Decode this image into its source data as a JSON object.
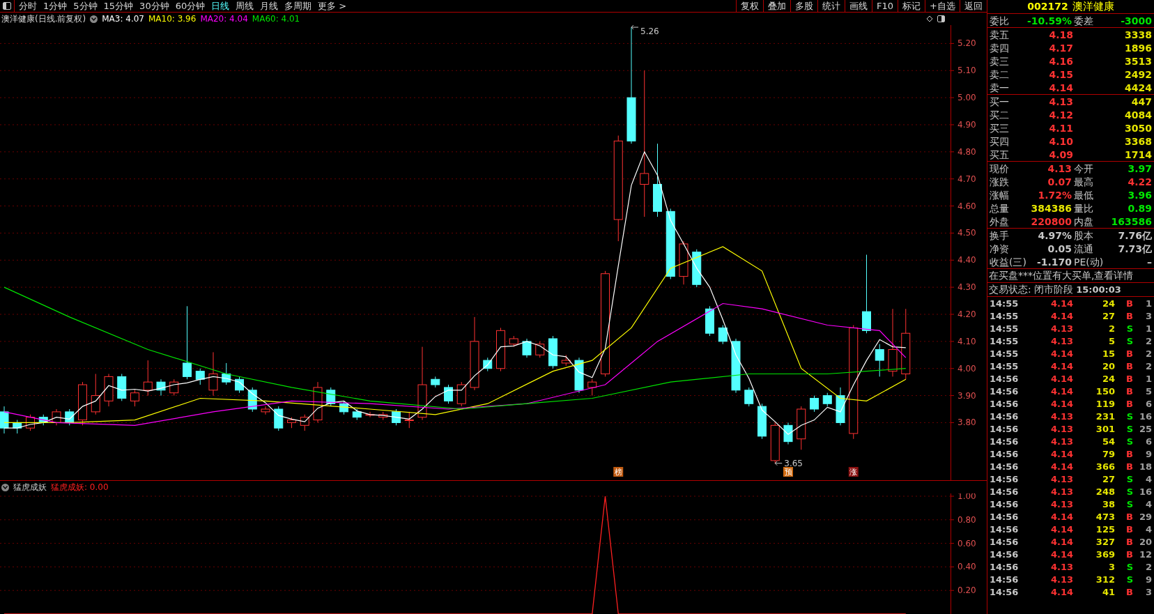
{
  "toolbar": {
    "periods": [
      {
        "label": "分时",
        "selected": false
      },
      {
        "label": "1分钟",
        "selected": false
      },
      {
        "label": "5分钟",
        "selected": false
      },
      {
        "label": "15分钟",
        "selected": false
      },
      {
        "label": "30分钟",
        "selected": false
      },
      {
        "label": "60分钟",
        "selected": false
      },
      {
        "label": "日线",
        "selected": true
      },
      {
        "label": "周线",
        "selected": false
      },
      {
        "label": "月线",
        "selected": false
      },
      {
        "label": "多周期",
        "selected": false
      },
      {
        "label": "更多 >",
        "selected": false
      }
    ],
    "buttons": [
      "复权",
      "叠加",
      "多股",
      "统计",
      "画线",
      "F10",
      "标记",
      "+自选",
      "返回"
    ]
  },
  "chart": {
    "title": "澳洋健康(日线.前复权)",
    "ma_legend": [
      {
        "label": "MA3: 4.07",
        "color": "#ffffff"
      },
      {
        "label": "MA10: 3.96",
        "color": "#ffff00"
      },
      {
        "label": "MA20: 4.04",
        "color": "#ff00ff"
      },
      {
        "label": "MA60: 4.01",
        "color": "#00e600"
      }
    ],
    "price_axis": [
      "5.20",
      "5.10",
      "5.00",
      "4.90",
      "4.80",
      "4.70",
      "4.60",
      "4.50",
      "4.40",
      "4.30",
      "4.20",
      "4.10",
      "4.00",
      "3.90",
      "3.80"
    ],
    "annotations": [
      {
        "label": "5.26",
        "kind": "high"
      },
      {
        "label": "3.65",
        "kind": "low"
      }
    ],
    "markers": [
      {
        "label": "榜",
        "color": "#c05a10"
      },
      {
        "label": "预",
        "color": "#d06a10"
      },
      {
        "label": "涨",
        "color": "#8b1010"
      }
    ]
  },
  "indicator": {
    "value_label": "猛虎成妖: 0.00",
    "chart_data": {
      "type": "line",
      "grid": true,
      "ylim": [
        0,
        1
      ],
      "yticks": [
        {
          "value": 1,
          "label": "1.00"
        },
        {
          "value": 0.8,
          "label": "0.80"
        },
        {
          "value": 0.6,
          "label": "0.60"
        },
        {
          "value": 0.4,
          "label": "0.40"
        },
        {
          "value": 0.2,
          "label": "0.20"
        }
      ],
      "series": [
        {
          "name": "猛虎成妖",
          "color": "#ff2020",
          "values": [
            0,
            0,
            0,
            0,
            0,
            0,
            0,
            0,
            0,
            0,
            0,
            0,
            0,
            0,
            0,
            0,
            0,
            0,
            0,
            0,
            0,
            0,
            0,
            0,
            0,
            0,
            0,
            0,
            0,
            0,
            0,
            0,
            0,
            0,
            0,
            0,
            0,
            0,
            0,
            0,
            0,
            0,
            0,
            0,
            0,
            0,
            1,
            0,
            0,
            0,
            0,
            0,
            0,
            0,
            0,
            0,
            0,
            0,
            0,
            0,
            0,
            0,
            0,
            0,
            0,
            0,
            0,
            0,
            0,
            0
          ]
        }
      ]
    }
  },
  "quote": {
    "code": "002172",
    "name": "澳洋健康",
    "order_ratio": [
      {
        "label": "委比",
        "value": "-10.59%",
        "color": "#00e600"
      },
      {
        "label": "委差",
        "value": "-3000",
        "color": "#00e600"
      }
    ],
    "asks": [
      {
        "label": "卖五",
        "price": "4.18",
        "volume": "3338"
      },
      {
        "label": "卖四",
        "price": "4.17",
        "volume": "1896"
      },
      {
        "label": "卖三",
        "price": "4.16",
        "volume": "3513"
      },
      {
        "label": "卖二",
        "price": "4.15",
        "volume": "2492"
      },
      {
        "label": "卖一",
        "price": "4.14",
        "volume": "4424"
      }
    ],
    "bids": [
      {
        "label": "买一",
        "price": "4.13",
        "volume": "447"
      },
      {
        "label": "买二",
        "price": "4.12",
        "volume": "4084"
      },
      {
        "label": "买三",
        "price": "4.11",
        "volume": "3050"
      },
      {
        "label": "买四",
        "price": "4.10",
        "volume": "3368"
      },
      {
        "label": "买五",
        "price": "4.09",
        "volume": "1714"
      }
    ],
    "stats": [
      {
        "label": "现价",
        "value": "4.13",
        "color": "#ff3232"
      },
      {
        "label": "今开",
        "value": "3.97",
        "color": "#00e600"
      },
      {
        "label": "涨跌",
        "value": "0.07",
        "color": "#ff3232"
      },
      {
        "label": "最高",
        "value": "4.22",
        "color": "#ff3232"
      },
      {
        "label": "涨幅",
        "value": "1.72%",
        "color": "#ff3232"
      },
      {
        "label": "最低",
        "value": "3.96",
        "color": "#00e600"
      },
      {
        "label": "总量",
        "value": "384386",
        "color": "#e6e600"
      },
      {
        "label": "量比",
        "value": "0.89",
        "color": "#00e600"
      },
      {
        "label": "外盘",
        "value": "220800",
        "color": "#ff3232"
      },
      {
        "label": "内盘",
        "value": "163586",
        "color": "#00e600"
      }
    ],
    "fundamentals": [
      {
        "label": "换手",
        "value": "4.97%"
      },
      {
        "label": "股本",
        "value": "7.76亿"
      },
      {
        "label": "净资",
        "value": "0.05"
      },
      {
        "label": "流通",
        "value": "7.73亿"
      },
      {
        "label": "收益(三)",
        "value": "-1.170"
      },
      {
        "label": "PE(动)",
        "value": "–"
      }
    ],
    "notice": "在买盘***位置有大买单,查看详情",
    "status": {
      "label": "交易状态: 闭市阶段",
      "time": "15:00:03"
    },
    "ticks": [
      {
        "time": "14:55",
        "price": "4.14",
        "volume": "24",
        "side": "B",
        "kind": "buy",
        "count": "1"
      },
      {
        "time": "14:55",
        "price": "4.14",
        "volume": "27",
        "side": "B",
        "kind": "buy",
        "count": "3"
      },
      {
        "time": "14:55",
        "price": "4.13",
        "volume": "2",
        "side": "S",
        "kind": "sell",
        "count": "1"
      },
      {
        "time": "14:55",
        "price": "4.13",
        "volume": "5",
        "side": "S",
        "kind": "sell",
        "count": "2"
      },
      {
        "time": "14:55",
        "price": "4.14",
        "volume": "15",
        "side": "B",
        "kind": "buy",
        "count": "2"
      },
      {
        "time": "14:55",
        "price": "4.14",
        "volume": "20",
        "side": "B",
        "kind": "buy",
        "count": "2"
      },
      {
        "time": "14:56",
        "price": "4.14",
        "volume": "24",
        "side": "B",
        "kind": "buy",
        "count": "1"
      },
      {
        "time": "14:56",
        "price": "4.14",
        "volume": "150",
        "side": "B",
        "kind": "buy",
        "count": "5"
      },
      {
        "time": "14:56",
        "price": "4.14",
        "volume": "119",
        "side": "B",
        "kind": "buy",
        "count": "6"
      },
      {
        "time": "14:56",
        "price": "4.13",
        "volume": "231",
        "side": "S",
        "kind": "sell",
        "count": "16"
      },
      {
        "time": "14:56",
        "price": "4.13",
        "volume": "301",
        "side": "S",
        "kind": "sell",
        "count": "25"
      },
      {
        "time": "14:56",
        "price": "4.13",
        "volume": "54",
        "side": "S",
        "kind": "sell",
        "count": "6"
      },
      {
        "time": "14:56",
        "price": "4.14",
        "volume": "79",
        "side": "B",
        "kind": "buy",
        "count": "9"
      },
      {
        "time": "14:56",
        "price": "4.14",
        "volume": "366",
        "side": "B",
        "kind": "buy",
        "count": "18"
      },
      {
        "time": "14:56",
        "price": "4.13",
        "volume": "27",
        "side": "S",
        "kind": "sell",
        "count": "4"
      },
      {
        "time": "14:56",
        "price": "4.13",
        "volume": "248",
        "side": "S",
        "kind": "sell",
        "count": "16"
      },
      {
        "time": "14:56",
        "price": "4.13",
        "volume": "38",
        "side": "S",
        "kind": "sell",
        "count": "4"
      },
      {
        "time": "14:56",
        "price": "4.14",
        "volume": "473",
        "side": "B",
        "kind": "buy",
        "count": "29"
      },
      {
        "time": "14:56",
        "price": "4.14",
        "volume": "125",
        "side": "B",
        "kind": "buy",
        "count": "4"
      },
      {
        "time": "14:56",
        "price": "4.14",
        "volume": "327",
        "side": "B",
        "kind": "buy",
        "count": "20"
      },
      {
        "time": "14:56",
        "price": "4.14",
        "volume": "369",
        "side": "B",
        "kind": "buy",
        "count": "12"
      },
      {
        "time": "14:56",
        "price": "4.13",
        "volume": "3",
        "side": "S",
        "kind": "sell",
        "count": "2"
      },
      {
        "time": "14:56",
        "price": "4.13",
        "volume": "312",
        "side": "S",
        "kind": "sell",
        "count": "9"
      },
      {
        "time": "14:56",
        "price": "4.14",
        "volume": "41",
        "side": "B",
        "kind": "buy",
        "count": "3"
      }
    ]
  }
}
